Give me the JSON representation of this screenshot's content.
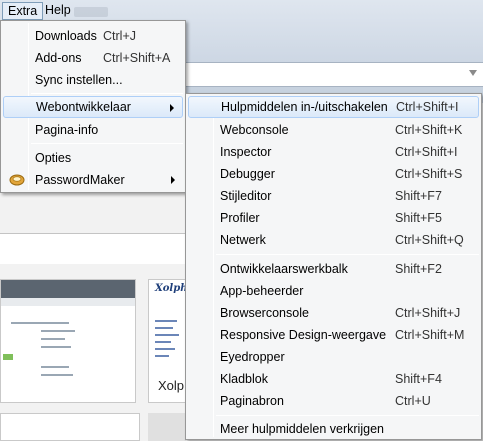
{
  "menubar": {
    "extra": "Extra",
    "help": "Help"
  },
  "main_menu": [
    {
      "label": "Downloads",
      "shortcut": "Ctrl+J"
    },
    {
      "label": "Add-ons",
      "shortcut": "Ctrl+Shift+A"
    },
    {
      "label": "Sync instellen..."
    },
    {
      "label": "Webontwikkelaar"
    },
    {
      "label": "Pagina-info"
    },
    {
      "label": "Opties"
    },
    {
      "label": "PasswordMaker"
    }
  ],
  "sub_menu": [
    {
      "label": "Hulpmiddelen in-/uitschakelen",
      "shortcut": "Ctrl+Shift+I"
    },
    {
      "label": "Webconsole",
      "shortcut": "Ctrl+Shift+K"
    },
    {
      "label": "Inspector",
      "shortcut": "Ctrl+Shift+I"
    },
    {
      "label": "Debugger",
      "shortcut": "Ctrl+Shift+S"
    },
    {
      "label": "Stijleditor",
      "shortcut": "Shift+F7"
    },
    {
      "label": "Profiler",
      "shortcut": "Shift+F5"
    },
    {
      "label": "Netwerk",
      "shortcut": "Ctrl+Shift+Q"
    },
    {
      "label": "Ontwikkelaarswerkbalk",
      "shortcut": "Shift+F2"
    },
    {
      "label": "App-beheerder"
    },
    {
      "label": "Browserconsole",
      "shortcut": "Ctrl+Shift+J"
    },
    {
      "label": "Responsive Design-weergave",
      "shortcut": "Ctrl+Shift+M"
    },
    {
      "label": "Eyedropper"
    },
    {
      "label": "Kladblok",
      "shortcut": "Shift+F4"
    },
    {
      "label": "Paginabron",
      "shortcut": "Ctrl+U"
    },
    {
      "label": "Meer hulpmiddelen verkrijgen"
    }
  ],
  "thumbnails": {
    "logo_text": "Xolphin",
    "caption": "Xolp"
  },
  "icons": {
    "submenu_arrow": "chevron-right-icon",
    "passwordmaker": "passwordmaker-icon",
    "url_dropdown": "dropdown-triangle-icon"
  },
  "colors": {
    "highlight_border": "#aecff7",
    "menu_bg": "#f5f6f7"
  }
}
